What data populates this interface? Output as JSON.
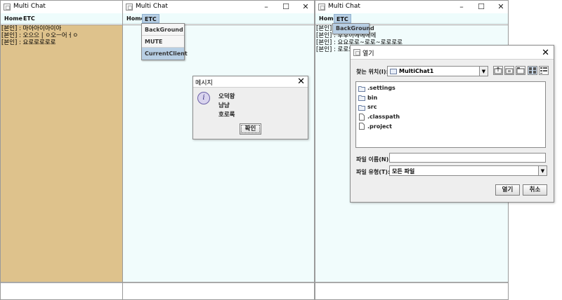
{
  "window1": {
    "title": "Multi Chat",
    "menu": [
      "Home",
      "ETC"
    ],
    "messages": [
      "[본인] : 마아아이아이아",
      "[본인] : 오으으 | ㅇ오ㅡ어ㅓㅇ",
      "[본인] : 요로로로로로"
    ]
  },
  "window2": {
    "title": "Multi Chat",
    "menu": [
      "Home",
      "ETC"
    ],
    "dropdown": [
      "BackGround",
      "MUTE",
      "CurrentClient"
    ],
    "dialog": {
      "title": "메시지",
      "lines": [
        "오덕왕",
        "냠냠",
        "호로록"
      ],
      "ok_label": "확인"
    }
  },
  "window3": {
    "title": "Multi Chat",
    "menu": [
      "Home",
      "ETC"
    ],
    "dropdown": [
      "BackGround"
    ],
    "messages": [
      "[본인] : 오",
      "[본인] : 후",
      "[본인] : 요",
      "[본인] : 로"
    ],
    "partial_text": [
      "후이에에에에",
      "요로로~로로~로로로로",
      "로드롤리"
    ]
  },
  "file_dialog": {
    "title": "열기",
    "lookin_label": "찾는 위치(I):",
    "lookin_value": "MultiChat1",
    "files": [
      {
        "name": ".settings",
        "icon": "folder-icon"
      },
      {
        "name": "bin",
        "icon": "folder-icon"
      },
      {
        "name": "src",
        "icon": "folder-icon"
      },
      {
        "name": ".classpath",
        "icon": "file-icon"
      },
      {
        "name": ".project",
        "icon": "file-icon"
      }
    ],
    "filename_label": "파일 이름(N):",
    "filename_value": "",
    "filetype_label": "파일 유형(T):",
    "filetype_value": "모든 파일",
    "open_label": "열기",
    "cancel_label": "취소"
  }
}
